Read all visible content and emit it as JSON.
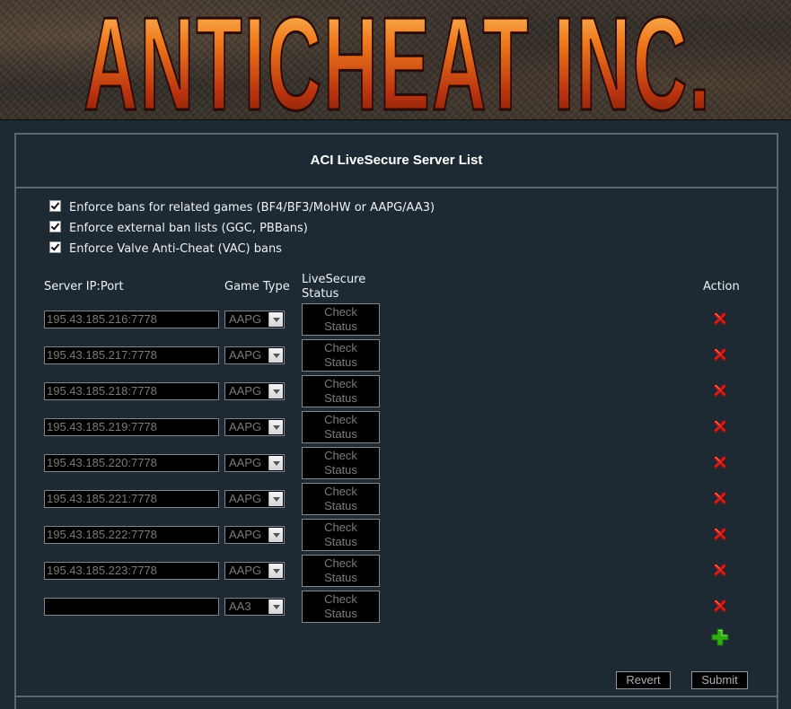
{
  "banner": {
    "logo_text": "ANTICHEAT INC."
  },
  "panel": {
    "title": "ACI LiveSecure Server List"
  },
  "options": [
    {
      "label": "Enforce bans for related games (BF4/BF3/MoHW or AAPG/AA3)",
      "checked": true
    },
    {
      "label": "Enforce external ban lists (GGC, PBBans)",
      "checked": true
    },
    {
      "label": "Enforce Valve Anti-Cheat (VAC) bans",
      "checked": true
    }
  ],
  "columns": {
    "server": "Server IP:Port",
    "game_type": "Game Type",
    "status_line1": "LiveSecure",
    "status_line2": "Status",
    "action": "Action"
  },
  "status_button_line1": "Check",
  "status_button_line2": "Status",
  "servers": [
    {
      "ip": "195.43.185.216:7778",
      "game": "AAPG"
    },
    {
      "ip": "195.43.185.217:7778",
      "game": "AAPG"
    },
    {
      "ip": "195.43.185.218:7778",
      "game": "AAPG"
    },
    {
      "ip": "195.43.185.219:7778",
      "game": "AAPG"
    },
    {
      "ip": "195.43.185.220:7778",
      "game": "AAPG"
    },
    {
      "ip": "195.43.185.221:7778",
      "game": "AAPG"
    },
    {
      "ip": "195.43.185.222:7778",
      "game": "AAPG"
    },
    {
      "ip": "195.43.185.223:7778",
      "game": "AAPG"
    },
    {
      "ip": "",
      "game": "AA3"
    }
  ],
  "buttons": {
    "revert": "Revert",
    "submit": "Submit"
  },
  "colors": {
    "background": "#1e2a33",
    "border": "#5b6670",
    "delete_red": "#d0201a",
    "add_green": "#2fae14"
  },
  "icons": {
    "delete": "red-x-icon",
    "add": "green-plus-icon",
    "dropdown": "chevron-down-icon",
    "checkbox": "checkmark-icon"
  }
}
